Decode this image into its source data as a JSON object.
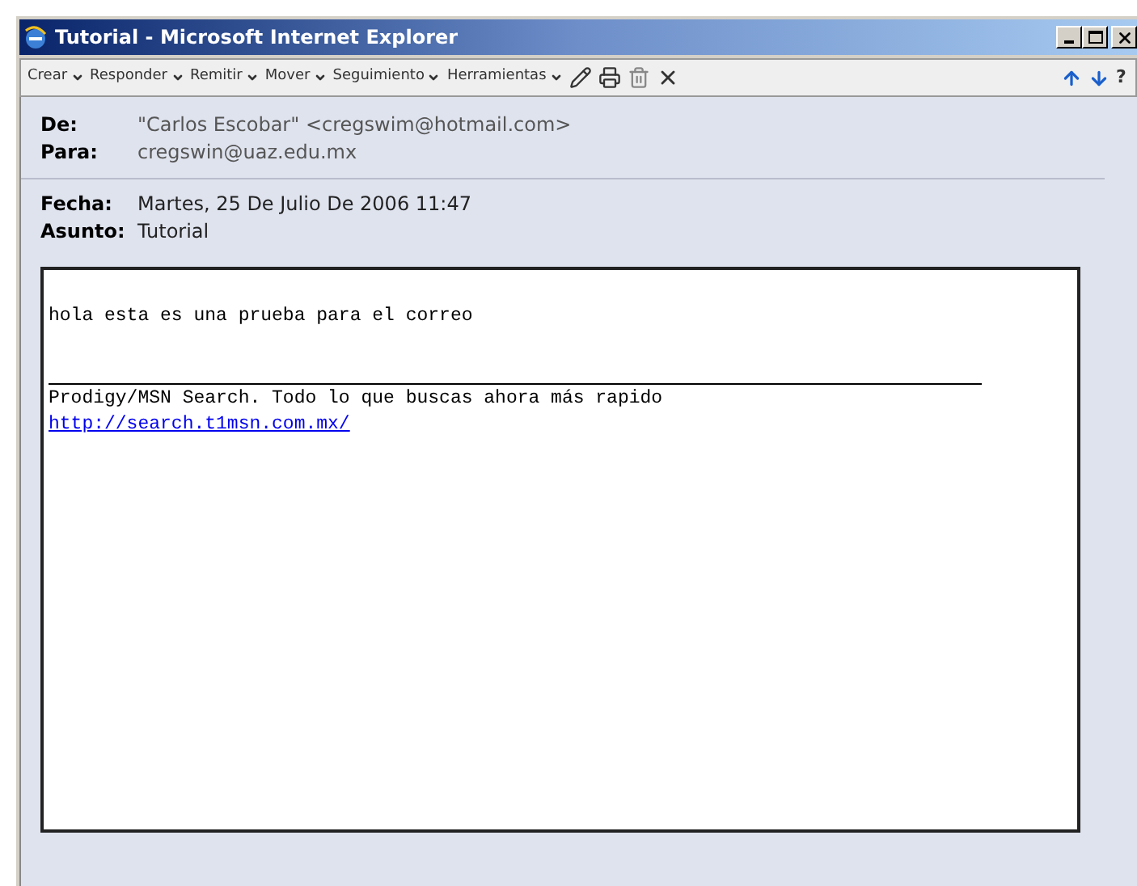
{
  "window": {
    "title": "Tutorial - Microsoft Internet Explorer"
  },
  "toolbar": {
    "menus": [
      "Crear",
      "Responder",
      "Remitir",
      "Mover",
      "Seguimiento",
      "Herramientas"
    ],
    "help": "?"
  },
  "header": {
    "from_label": "De:",
    "from": "\"Carlos Escobar\" <cregswim@hotmail.com>",
    "to_label": "Para:",
    "to": "cregswin@uaz.edu.mx",
    "date_label": "Fecha:",
    "date": "Martes, 25 De Julio De 2006 11:47",
    "subject_label": "Asunto:",
    "subject": "Tutorial"
  },
  "body": {
    "text": "hola esta es una prueba para el correo",
    "footer": "Prodigy/MSN Search. Todo lo que buscas ahora más rapido",
    "link": "http://search.t1msn.com.mx/"
  }
}
